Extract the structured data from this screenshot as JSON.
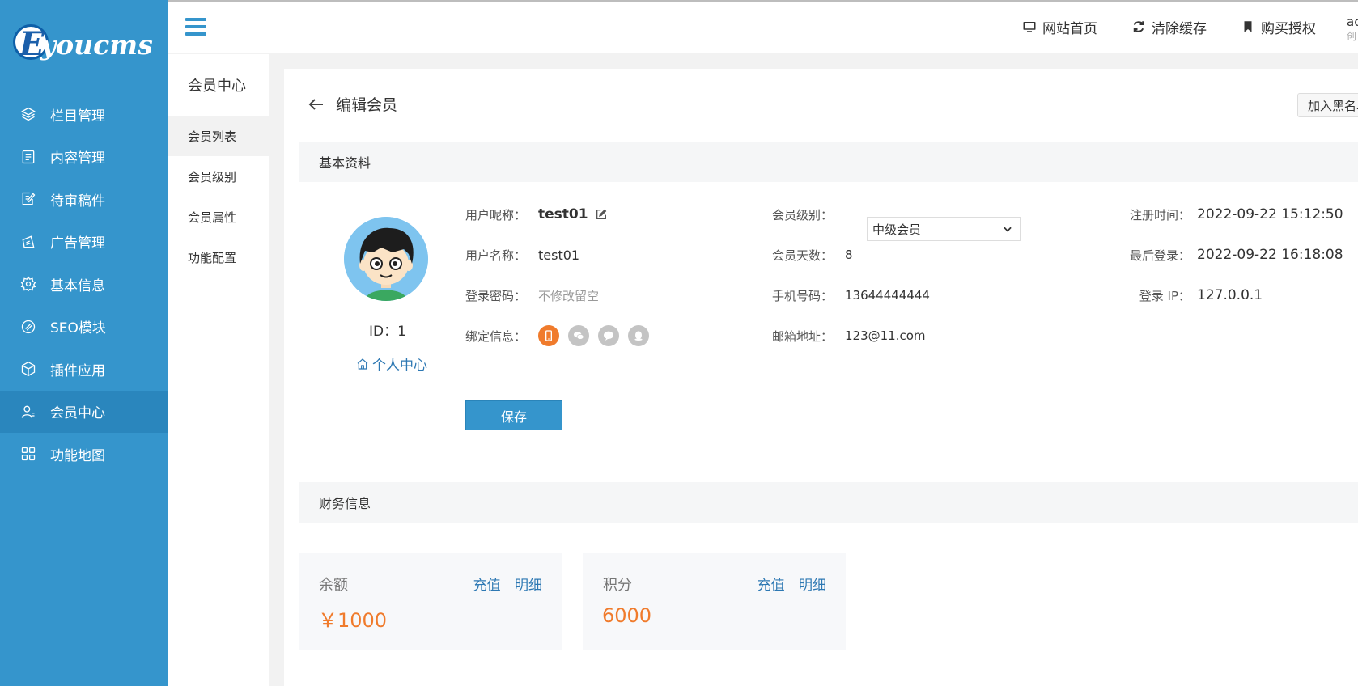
{
  "brand": {
    "logo_letter": "E",
    "logo_text": "youcms"
  },
  "sidebar": {
    "items": [
      {
        "label": "栏目管理",
        "icon": "layers-icon"
      },
      {
        "label": "内容管理",
        "icon": "document-icon"
      },
      {
        "label": "待审稿件",
        "icon": "edit-document-icon"
      },
      {
        "label": "广告管理",
        "icon": "ad-icon"
      },
      {
        "label": "基本信息",
        "icon": "gear-icon"
      },
      {
        "label": "SEO模块",
        "icon": "seo-icon"
      },
      {
        "label": "插件应用",
        "icon": "cube-icon"
      },
      {
        "label": "会员中心",
        "icon": "user-icon",
        "active": true
      },
      {
        "label": "功能地图",
        "icon": "grid-icon"
      }
    ]
  },
  "header": {
    "links": [
      {
        "label": "网站首页",
        "icon": "monitor-icon"
      },
      {
        "label": "清除缓存",
        "icon": "refresh-icon"
      },
      {
        "label": "购买授权",
        "icon": "bookmark-icon"
      }
    ],
    "user_name": "ac",
    "user_sub": "创"
  },
  "subnav": {
    "title": "会员中心",
    "items": [
      {
        "label": "会员列表",
        "active": true
      },
      {
        "label": "会员级别"
      },
      {
        "label": "会员属性"
      },
      {
        "label": "功能配置"
      }
    ]
  },
  "page": {
    "title": "编辑会员",
    "blacklist_label": "加入黑名单",
    "section_basic": "基本资料",
    "section_finance": "财务信息",
    "save_label": "保存"
  },
  "member": {
    "id_text": "ID：1",
    "personal_center": "个人中心",
    "nickname_label": "用户昵称：",
    "nickname": "test01",
    "username_label": "用户名称：",
    "username": "test01",
    "password_label": "登录密码：",
    "password_placeholder": "不修改留空",
    "bind_label": "绑定信息：",
    "level_label": "会员级别：",
    "level_value": "中级会员",
    "days_label": "会员天数：",
    "days_value": "8",
    "phone_label": "手机号码：",
    "phone_value": "13644444444",
    "email_label": "邮箱地址：",
    "email_value": "123@11.com",
    "reg_time_label": "注册时间：",
    "reg_time_value": "2022-09-22 15:12:50",
    "last_login_label": "最后登录：",
    "last_login_value": "2022-09-22 16:18:08",
    "login_ip_label": "登录 IP：",
    "login_ip_value": "127.0.0.1"
  },
  "finance": {
    "balance_label": "余额",
    "balance_value": "￥1000",
    "points_label": "积分",
    "points_value": "6000",
    "recharge_label": "充值",
    "detail_label": "明细"
  },
  "colors": {
    "sidebar_bg": "#3595cc",
    "sidebar_active": "#2a86bd",
    "accent_orange": "#f07b2c",
    "link_blue": "#2d78b3"
  }
}
